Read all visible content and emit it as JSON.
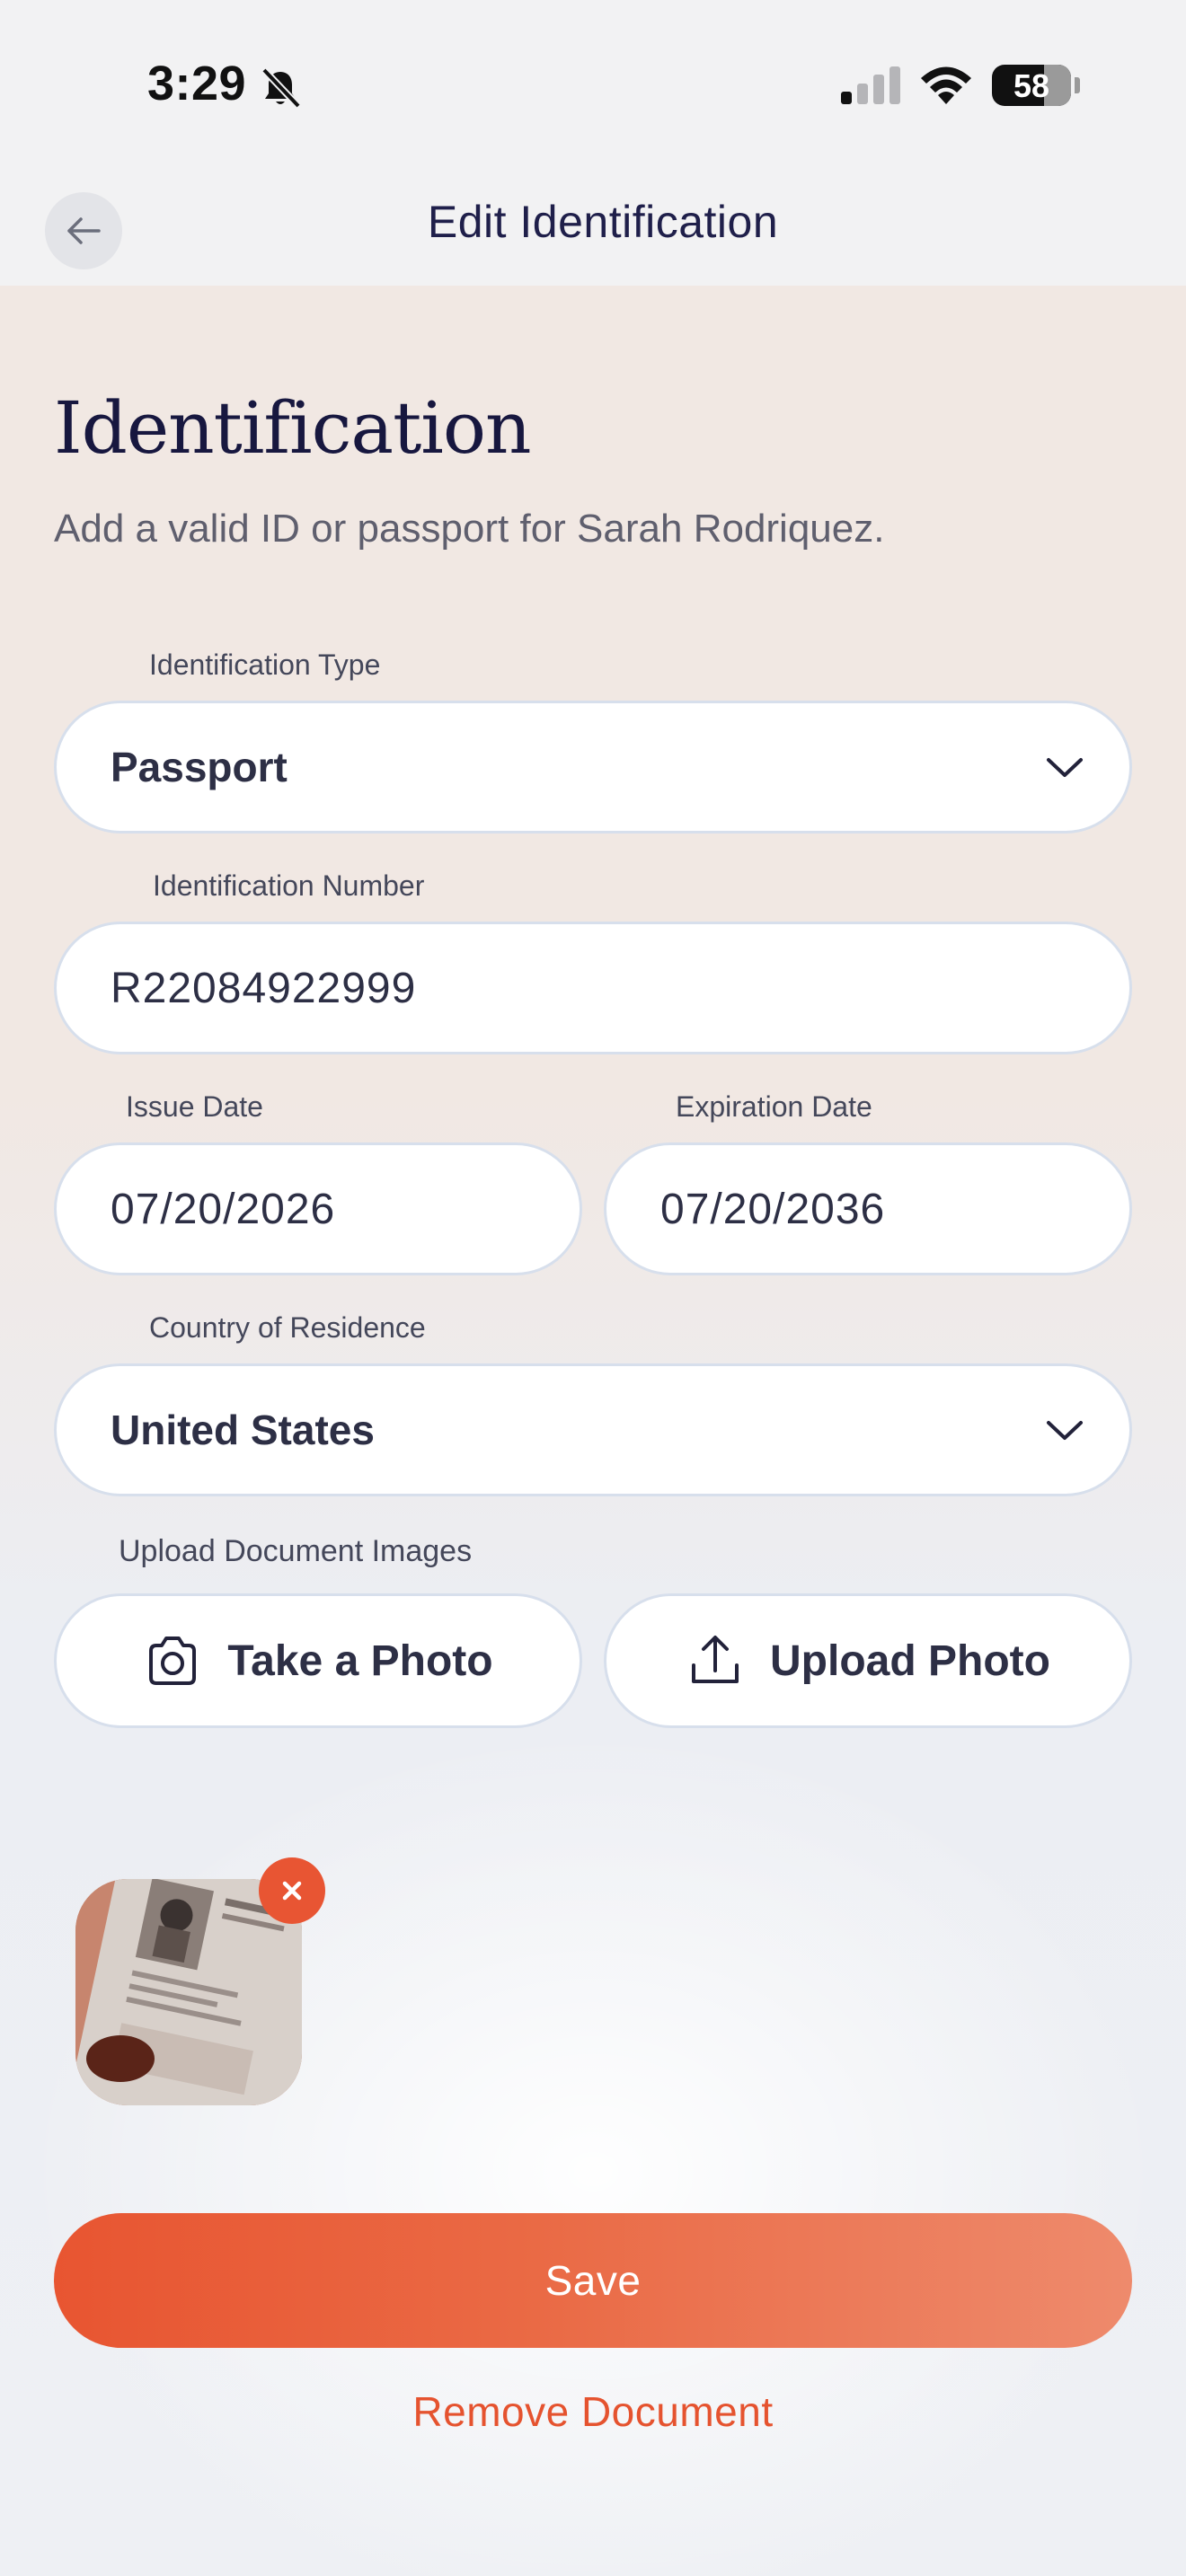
{
  "status_bar": {
    "time": "3:29",
    "battery": "58"
  },
  "header": {
    "title": "Edit Identification"
  },
  "main": {
    "heading": "Identification",
    "subtitle": "Add a valid ID or passport for Sarah Rodriquez."
  },
  "form": {
    "id_type": {
      "label": "Identification Type",
      "value": "Passport"
    },
    "id_number": {
      "label": "Identification Number",
      "value": "R22084922999"
    },
    "issue_date": {
      "label": "Issue Date",
      "value": "07/20/2026"
    },
    "expiration_date": {
      "label": "Expiration Date",
      "value": "07/20/2036"
    },
    "country": {
      "label": "Country of Residence",
      "value": "United States"
    },
    "upload": {
      "label": "Upload Document Images",
      "take_photo": "Take a Photo",
      "upload_photo": "Upload Photo"
    }
  },
  "actions": {
    "save": "Save",
    "remove_document": "Remove Document"
  },
  "colors": {
    "accent": "#e85533",
    "title": "#17173f"
  }
}
